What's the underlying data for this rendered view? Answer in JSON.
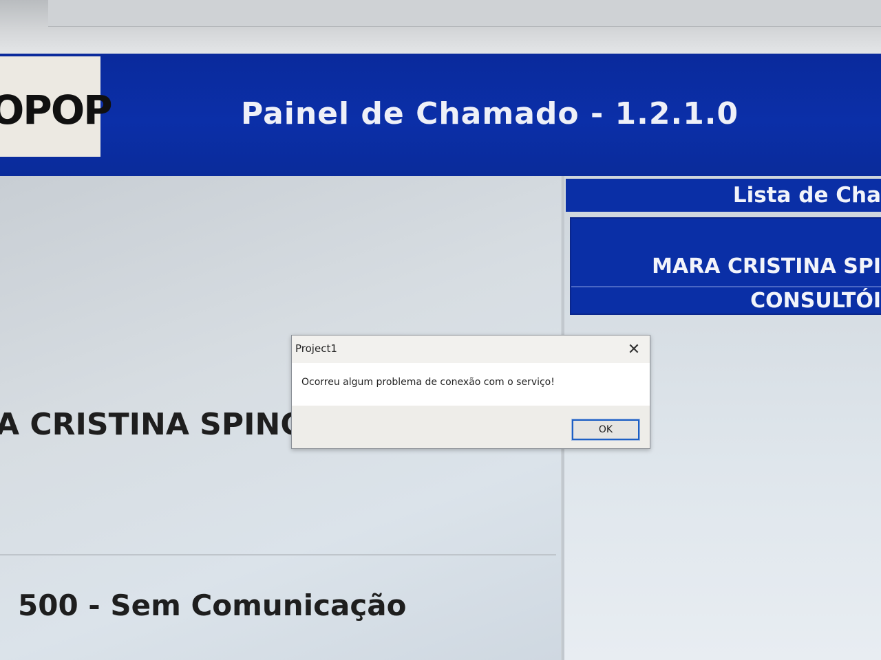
{
  "header": {
    "logo_text": "OPOP",
    "app_title": "Painel de Chamado - 1.2.1.0"
  },
  "main": {
    "patient_name": "A CRISTINA SPINO",
    "status": "500 - Sem Comunicação"
  },
  "call_list": {
    "header": "Lista de Cha",
    "items": [
      {
        "name": "MARA CRISTINA SPI",
        "location": "CONSULTÓI"
      }
    ]
  },
  "dialog": {
    "title": "Project1",
    "close_glyph": "✕",
    "message": "Ocorreu algum problema de conexão com o serviço!",
    "ok_label": "OK"
  },
  "colors": {
    "header_blue": "#0b2fa8",
    "panel_gray": "#d7dde2",
    "dialog_focus": "#1d5fc4"
  }
}
